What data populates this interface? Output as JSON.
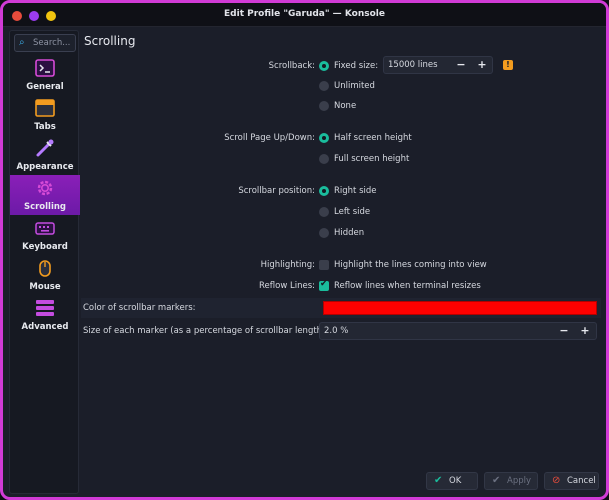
{
  "window": {
    "title": "Edit Profile \"Garuda\" — Konsole",
    "controls": {
      "close_color": "#e74c3c",
      "minimize_color": "#9b3cf0",
      "maximize_color": "#f1c40f"
    },
    "border_color": "#d13bd6"
  },
  "sidebar": {
    "search_placeholder": "Search...",
    "items": [
      {
        "label": "General",
        "icon": "terminal-icon"
      },
      {
        "label": "Tabs",
        "icon": "tabs-icon"
      },
      {
        "label": "Appearance",
        "icon": "color-picker-icon"
      },
      {
        "label": "Scrolling",
        "icon": "gear-icon",
        "active": true
      },
      {
        "label": "Keyboard",
        "icon": "keyboard-icon"
      },
      {
        "label": "Mouse",
        "icon": "mouse-icon"
      },
      {
        "label": "Advanced",
        "icon": "advanced-icon"
      }
    ],
    "active_color": "#8a1fb8"
  },
  "main": {
    "title": "Scrolling",
    "scrollback": {
      "label": "Scrollback:",
      "options": [
        "Fixed size:",
        "Unlimited",
        "None"
      ],
      "selected": 0,
      "fixed_size_value": "15000 lines",
      "minus": "−",
      "plus": "+",
      "warning": "!"
    },
    "scroll_page": {
      "label": "Scroll Page Up/Down:",
      "options": [
        "Half screen height",
        "Full screen height"
      ],
      "selected": 0
    },
    "scrollbar_position": {
      "label": "Scrollbar position:",
      "options": [
        "Right side",
        "Left side",
        "Hidden"
      ],
      "selected": 0
    },
    "highlighting": {
      "label": "Highlighting:",
      "option": "Highlight the lines coming into view",
      "checked": false
    },
    "reflow": {
      "label": "Reflow Lines:",
      "option": "Reflow lines when terminal resizes",
      "checked": true
    },
    "marker_color": {
      "label": "Color of scrollbar markers:",
      "value": "#ff0000"
    },
    "marker_size": {
      "label": "Size of each marker (as a percentage of scrollbar length):",
      "value": "2.0 %",
      "minus": "−",
      "plus": "+"
    }
  },
  "footer": {
    "ok": "OK",
    "apply": "Apply",
    "cancel": "Cancel"
  }
}
